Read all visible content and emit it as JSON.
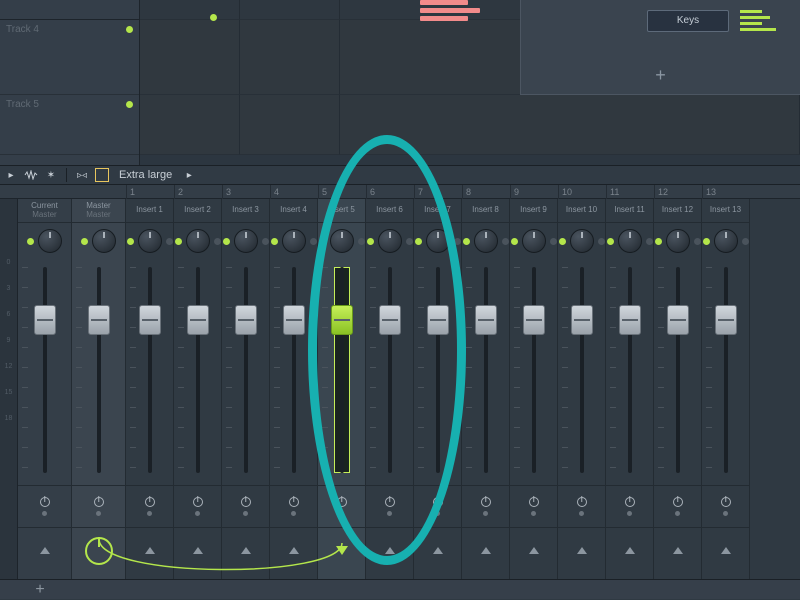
{
  "playlist": {
    "tracks": [
      {
        "label": "Track 4"
      },
      {
        "label": "Track 5"
      }
    ]
  },
  "keys_panel": {
    "button_label": "Keys",
    "plus": "+"
  },
  "mixer_toolbar": {
    "size_label": "Extra large"
  },
  "mixer": {
    "current_label": "Current",
    "current_sub": "Master",
    "master_label": "Master",
    "master_sub": "Master",
    "ruler": [
      "1",
      "2",
      "3",
      "4",
      "5",
      "6",
      "7",
      "8",
      "9",
      "10",
      "11",
      "12",
      "13"
    ],
    "inserts": [
      "Insert 1",
      "Insert 2",
      "Insert 3",
      "Insert 4",
      "Insert 5",
      "Insert 6",
      "Insert 7",
      "Insert 8",
      "Insert 9",
      "Insert 10",
      "Insert 11",
      "Insert 12",
      "Insert 13"
    ],
    "db_scale": [
      "0",
      "3",
      "6",
      "9",
      "12",
      "15",
      "18"
    ],
    "selected_index": 4,
    "highlighted_index": 4
  },
  "bottom": {
    "plus": "+"
  }
}
